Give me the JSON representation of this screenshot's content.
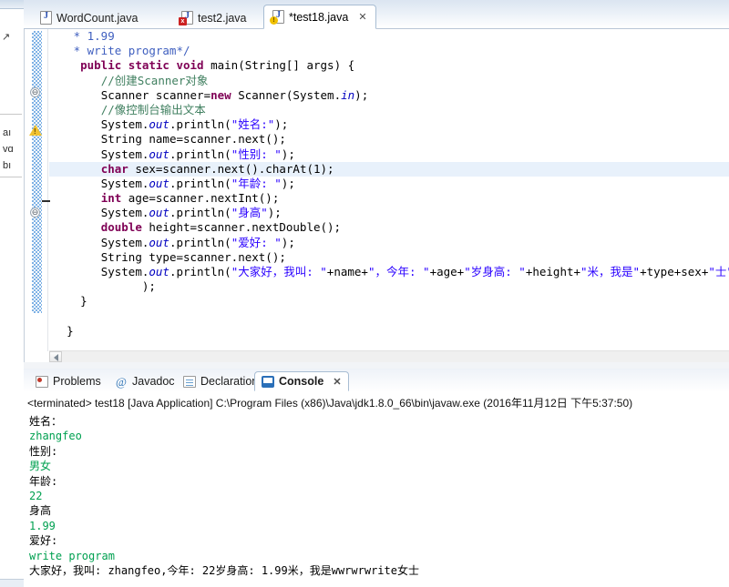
{
  "editor": {
    "tabs": [
      {
        "label": "WordCount.java",
        "icon": "java-file-icon",
        "badge": "none",
        "active": false,
        "closable": false
      },
      {
        "label": "test2.java",
        "icon": "java-file-icon",
        "badge": "error",
        "active": false,
        "closable": false
      },
      {
        "label": "*test18.java",
        "icon": "java-file-icon",
        "badge": "warning",
        "active": true,
        "closable": true,
        "close_glyph": "✕"
      }
    ],
    "gutter": {
      "warning_marker": "warning-icon",
      "fold_collapsed": "⊖",
      "fold_expanded": "⊖"
    },
    "scroll": {
      "left_arrow": "◀"
    },
    "code_lines": [
      {
        "indent": 3,
        "parts": [
          {
            "t": "* 1.99",
            "c": "jdoc"
          }
        ]
      },
      {
        "indent": 3,
        "parts": [
          {
            "t": "* write program*/",
            "c": "jdoc"
          }
        ]
      },
      {
        "indent": 4,
        "parts": [
          {
            "t": "public static void ",
            "c": "kw"
          },
          {
            "t": "main(String[] args) {",
            "c": ""
          }
        ]
      },
      {
        "indent": 7,
        "parts": [
          {
            "t": "//创建Scanner对象",
            "c": "cmt"
          }
        ]
      },
      {
        "indent": 7,
        "parts": [
          {
            "t": "Scanner scanner=",
            "c": ""
          },
          {
            "t": "new",
            "c": "kw"
          },
          {
            "t": " Scanner(System.",
            "c": ""
          },
          {
            "t": "in",
            "c": "fld"
          },
          {
            "t": ");",
            "c": ""
          }
        ]
      },
      {
        "indent": 7,
        "parts": [
          {
            "t": "//像控制台输出文本",
            "c": "cmt"
          }
        ]
      },
      {
        "indent": 7,
        "parts": [
          {
            "t": "System.",
            "c": ""
          },
          {
            "t": "out",
            "c": "fld"
          },
          {
            "t": ".println(",
            "c": ""
          },
          {
            "t": "\"姓名:\"",
            "c": "str"
          },
          {
            "t": ");",
            "c": ""
          }
        ]
      },
      {
        "indent": 7,
        "parts": [
          {
            "t": "String name=scanner.next();",
            "c": ""
          }
        ]
      },
      {
        "indent": 7,
        "parts": [
          {
            "t": "System.",
            "c": ""
          },
          {
            "t": "out",
            "c": "fld"
          },
          {
            "t": ".println(",
            "c": ""
          },
          {
            "t": "\"性别: \"",
            "c": "str"
          },
          {
            "t": ");",
            "c": ""
          }
        ]
      },
      {
        "indent": 7,
        "highlight": true,
        "parts": [
          {
            "t": "char",
            "c": "kw"
          },
          {
            "t": " sex=scanner.next().charAt(1);",
            "c": ""
          }
        ]
      },
      {
        "indent": 7,
        "parts": [
          {
            "t": "System.",
            "c": ""
          },
          {
            "t": "out",
            "c": "fld"
          },
          {
            "t": ".println(",
            "c": ""
          },
          {
            "t": "\"年龄: \"",
            "c": "str"
          },
          {
            "t": ");",
            "c": ""
          }
        ]
      },
      {
        "indent": 7,
        "parts": [
          {
            "t": "int",
            "c": "kw"
          },
          {
            "t": " age=scanner.nextInt();",
            "c": ""
          }
        ]
      },
      {
        "indent": 7,
        "parts": [
          {
            "t": "System.",
            "c": ""
          },
          {
            "t": "out",
            "c": "fld"
          },
          {
            "t": ".println(",
            "c": ""
          },
          {
            "t": "\"身高\"",
            "c": "str"
          },
          {
            "t": ");",
            "c": ""
          }
        ]
      },
      {
        "indent": 7,
        "parts": [
          {
            "t": "double",
            "c": "kw"
          },
          {
            "t": " height=scanner.nextDouble();",
            "c": ""
          }
        ]
      },
      {
        "indent": 7,
        "parts": [
          {
            "t": "System.",
            "c": ""
          },
          {
            "t": "out",
            "c": "fld"
          },
          {
            "t": ".println(",
            "c": ""
          },
          {
            "t": "\"爱好: \"",
            "c": "str"
          },
          {
            "t": ");",
            "c": ""
          }
        ]
      },
      {
        "indent": 7,
        "parts": [
          {
            "t": "String type=scanner.next();",
            "c": ""
          }
        ]
      },
      {
        "indent": 7,
        "parts": [
          {
            "t": "System.",
            "c": ""
          },
          {
            "t": "out",
            "c": "fld"
          },
          {
            "t": ".println(",
            "c": ""
          },
          {
            "t": "\"大家好，我叫: \"",
            "c": "str"
          },
          {
            "t": "+name+",
            "c": ""
          },
          {
            "t": "\"，今年: \"",
            "c": "str"
          },
          {
            "t": "+age+",
            "c": ""
          },
          {
            "t": "\"岁身高: \"",
            "c": "str"
          },
          {
            "t": "+height+",
            "c": ""
          },
          {
            "t": "\"米，我是\"",
            "c": "str"
          },
          {
            "t": "+type+sex+",
            "c": ""
          },
          {
            "t": "\"士\"",
            "c": "str"
          }
        ]
      },
      {
        "indent": 13,
        "parts": [
          {
            "t": ");",
            "c": ""
          }
        ]
      },
      {
        "indent": 4,
        "parts": [
          {
            "t": "}",
            "c": ""
          }
        ]
      },
      {
        "indent": 0,
        "parts": [
          {
            "t": "",
            "c": ""
          }
        ]
      },
      {
        "indent": 2,
        "parts": [
          {
            "t": "}",
            "c": ""
          }
        ]
      }
    ]
  },
  "bottom_view": {
    "tabs": [
      {
        "label": "Problems",
        "icon": "problems-icon",
        "active": false,
        "closable": false
      },
      {
        "label": "Javadoc",
        "icon": "javadoc-icon",
        "active": false,
        "closable": false
      },
      {
        "label": "Declaration",
        "icon": "declaration-icon",
        "active": false,
        "closable": false
      },
      {
        "label": "Console",
        "icon": "console-icon",
        "active": true,
        "closable": true,
        "close_glyph": "✕"
      }
    ],
    "terminated_line": "<terminated> test18 [Java Application] C:\\Program Files (x86)\\Java\\jdk1.8.0_66\\bin\\javaw.exe (2016年11月12日 下午5:37:50)",
    "output": [
      {
        "text": "姓名：",
        "kind": "prompt"
      },
      {
        "text": "zhangfeo",
        "kind": "input"
      },
      {
        "text": "性别:",
        "kind": "prompt"
      },
      {
        "text": "男女",
        "kind": "input"
      },
      {
        "text": "年龄:",
        "kind": "prompt"
      },
      {
        "text": "22",
        "kind": "input"
      },
      {
        "text": "身高",
        "kind": "prompt"
      },
      {
        "text": "1.99",
        "kind": "input"
      },
      {
        "text": "爱好:",
        "kind": "prompt"
      },
      {
        "text": "write program",
        "kind": "input"
      },
      {
        "text": "大家好，我叫: zhangfeo,今年: 22岁身高: 1.99米，我是wwrwrwrite女士",
        "kind": "final"
      }
    ]
  },
  "left_strip": {
    "arrow_glyph": "↗",
    "rows": [
      "aı",
      "vɑ",
      "bı"
    ]
  },
  "colors": {
    "keyword": "#7f0055",
    "comment": "#3f7f5f",
    "string": "#2a00ff",
    "field": "#0000c0",
    "javadoc": "#3f5fbf",
    "console_input": "#00a050",
    "highlight_line": "#e8f1fb",
    "change_bar": "#7fb2e5"
  }
}
